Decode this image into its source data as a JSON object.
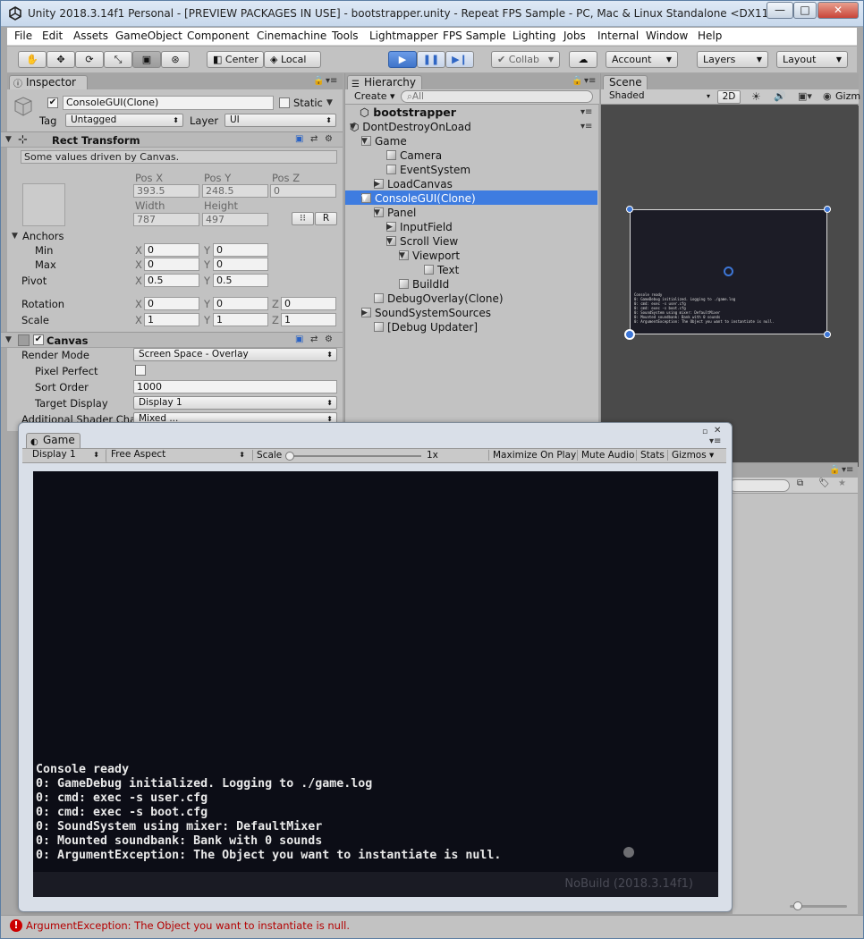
{
  "window": {
    "title": "Unity 2018.3.14f1 Personal - [PREVIEW PACKAGES IN USE] - bootstrapper.unity - Repeat FPS Sample - PC, Mac & Linux Standalone <DX11>",
    "min_glyph": "—",
    "max_glyph": "□",
    "close_glyph": "✕"
  },
  "menu": [
    "File",
    "Edit",
    "Assets",
    "GameObject",
    "Component",
    "Cinemachine",
    "Tools",
    "Lightmapper",
    "FPS Sample",
    "Lighting",
    "Jobs",
    "Internal",
    "Window",
    "Help"
  ],
  "toolbar": {
    "tools": [
      "hand-icon",
      "move-icon",
      "rotate-icon",
      "scale-icon",
      "rect-icon",
      "transform-icon"
    ],
    "pivot_label": "Center",
    "space_label": "Local",
    "collab_label": "Collab",
    "account_label": "Account",
    "layers_label": "Layers",
    "layout_label": "Layout"
  },
  "inspector": {
    "tab": "Inspector",
    "object_name": "ConsoleGUI(Clone)",
    "static_label": "Static",
    "tag_label": "Tag",
    "tag_value": "Untagged",
    "layer_label": "Layer",
    "layer_value": "UI",
    "rect_transform": {
      "title": "Rect Transform",
      "note": "Some values driven by Canvas.",
      "pos_x_label": "Pos X",
      "pos_y_label": "Pos Y",
      "pos_z_label": "Pos Z",
      "pos_x": "393.5",
      "pos_y": "248.5",
      "pos_z": "0",
      "width_label": "Width",
      "height_label": "Height",
      "width": "787",
      "height": "497",
      "r_label": "R",
      "anchors_label": "Anchors",
      "min_label": "Min",
      "max_label": "Max",
      "min_x": "0",
      "min_y": "0",
      "max_x": "0",
      "max_y": "0",
      "pivot_label": "Pivot",
      "pivot_x": "0.5",
      "pivot_y": "0.5",
      "rotation_label": "Rotation",
      "rot_x": "0",
      "rot_y": "0",
      "rot_z": "0",
      "scale_label": "Scale",
      "scale_x": "1",
      "scale_y": "1",
      "scale_z": "1",
      "x": "X",
      "y": "Y",
      "z": "Z"
    },
    "canvas": {
      "title": "Canvas",
      "render_mode_label": "Render Mode",
      "render_mode": "Screen Space - Overlay",
      "pixel_perfect_label": "Pixel Perfect",
      "sort_order_label": "Sort Order",
      "sort_order": "1000",
      "target_display_label": "Target Display",
      "target_display": "Display 1",
      "shader_label": "Additional Shader Cha",
      "shader_value": "Mixed ..."
    }
  },
  "hierarchy": {
    "tab": "Hierarchy",
    "create_label": "Create",
    "search_placeholder": "All",
    "items": [
      {
        "label": "bootstrapper"
      },
      {
        "label": "DontDestroyOnLoad"
      },
      {
        "label": "Game"
      },
      {
        "label": "Camera"
      },
      {
        "label": "EventSystem"
      },
      {
        "label": "LoadCanvas"
      },
      {
        "label": "ConsoleGUI(Clone)"
      },
      {
        "label": "Panel"
      },
      {
        "label": "InputField"
      },
      {
        "label": "Scroll View"
      },
      {
        "label": "Viewport"
      },
      {
        "label": "Text"
      },
      {
        "label": "BuildId"
      },
      {
        "label": "DebugOverlay(Clone)"
      },
      {
        "label": "SoundSystemSources"
      },
      {
        "label": "[Debug Updater]"
      }
    ]
  },
  "scene": {
    "tab": "Scene",
    "shading": "Shaded",
    "mode_2d": "2D",
    "gizmos": "Gizm"
  },
  "game": {
    "tab": "Game",
    "display": "Display 1",
    "aspect": "Free Aspect",
    "scale_label": "Scale",
    "scale_value": "1x",
    "maximize_label": "Maximize On Play",
    "mute_label": "Mute Audio",
    "stats_label": "Stats",
    "gizmos_label": "Gizmos",
    "console_lines": [
      "Console ready",
      "0: GameDebug initialized. Logging to ./game.log",
      "0: cmd: exec -s user.cfg",
      "0: cmd: exec -s boot.cfg",
      "0: SoundSystem using mixer: DefaultMixer",
      "0: Mounted soundbank: Bank with 0 sounds",
      "0: ArgumentException: The Object you want to instantiate is null."
    ],
    "build_id": "NoBuild (2018.3.14f1)"
  },
  "status": {
    "message": "ArgumentException: The Object you want to instantiate is null.",
    "error_color": "#cc0000"
  }
}
